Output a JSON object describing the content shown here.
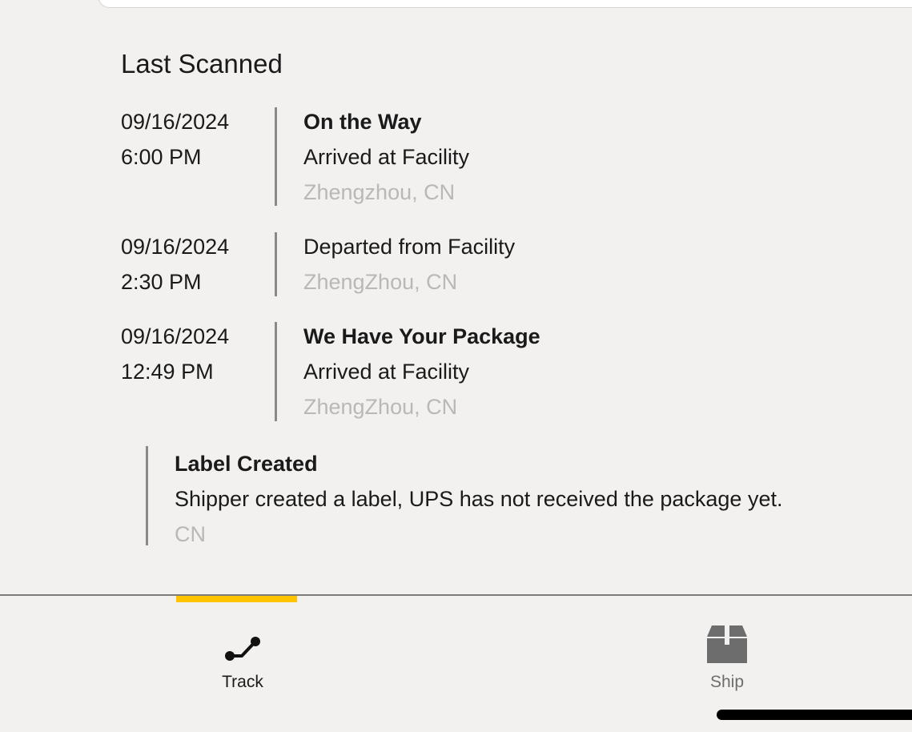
{
  "title": "Last Scanned",
  "scans": [
    {
      "date": "09/16/2024",
      "time": "6:00 PM",
      "status": "On the Way",
      "description": "Arrived at Facility",
      "location": "Zhengzhou, CN"
    },
    {
      "date": "09/16/2024",
      "time": "2:30 PM",
      "status": "",
      "description": "Departed from Facility",
      "location": "ZhengZhou, CN"
    },
    {
      "date": "09/16/2024",
      "time": "12:49 PM",
      "status": "We Have Your Package",
      "description": "Arrived at Facility",
      "location": "ZhengZhou, CN"
    }
  ],
  "label_created": {
    "status": "Label Created",
    "description": "Shipper created a label, UPS has not received the package yet.",
    "location": "CN"
  },
  "nav": {
    "track_label": "Track",
    "ship_label": "Ship",
    "active": "track",
    "accent_color": "#ffc400"
  },
  "icons": {
    "track": "route-icon",
    "ship": "box-icon"
  }
}
